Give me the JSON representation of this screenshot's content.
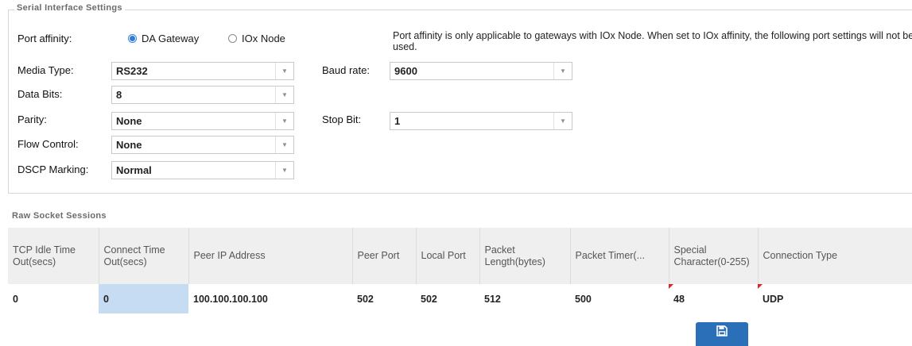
{
  "serial_settings": {
    "legend": "Serial Interface Settings",
    "port_affinity": {
      "label": "Port affinity:",
      "options": [
        {
          "label": "DA Gateway",
          "checked": true
        },
        {
          "label": "IOx Node",
          "checked": false
        }
      ]
    },
    "note": "Port affinity is only applicable to gateways with IOx Node. When set to IOx affinity, the following port settings will not be used.",
    "media_type": {
      "label": "Media Type:",
      "value": "RS232"
    },
    "data_bits": {
      "label": "Data Bits:",
      "value": "8"
    },
    "parity": {
      "label": "Parity:",
      "value": "None"
    },
    "flow_control": {
      "label": "Flow Control:",
      "value": "None"
    },
    "dscp_marking": {
      "label": "DSCP Marking:",
      "value": "Normal"
    },
    "baud_rate": {
      "label": "Baud rate:",
      "value": "9600"
    },
    "stop_bit": {
      "label": "Stop Bit:",
      "value": "1"
    }
  },
  "raw_socket": {
    "title": "Raw Socket Sessions",
    "columns": [
      "TCP Idle Time Out(secs)",
      "Connect Time Out(secs)",
      "Peer IP Address",
      "Peer Port",
      "Local Port",
      "Packet Length(bytes)",
      "Packet Timer(...",
      "Special Character(0-255)",
      "Connection Type"
    ],
    "rows": [
      [
        "0",
        "0",
        "100.100.100.100",
        "502",
        "502",
        "512",
        "500",
        "48",
        "UDP"
      ]
    ]
  },
  "save_button": {
    "icon": "floppy-disk-icon",
    "color": "#2a6fb8"
  },
  "colors": {
    "selected_cell": "#c6dcf3",
    "radio_checked": "#2f7bd8",
    "dirty_marker": "#d22222"
  }
}
